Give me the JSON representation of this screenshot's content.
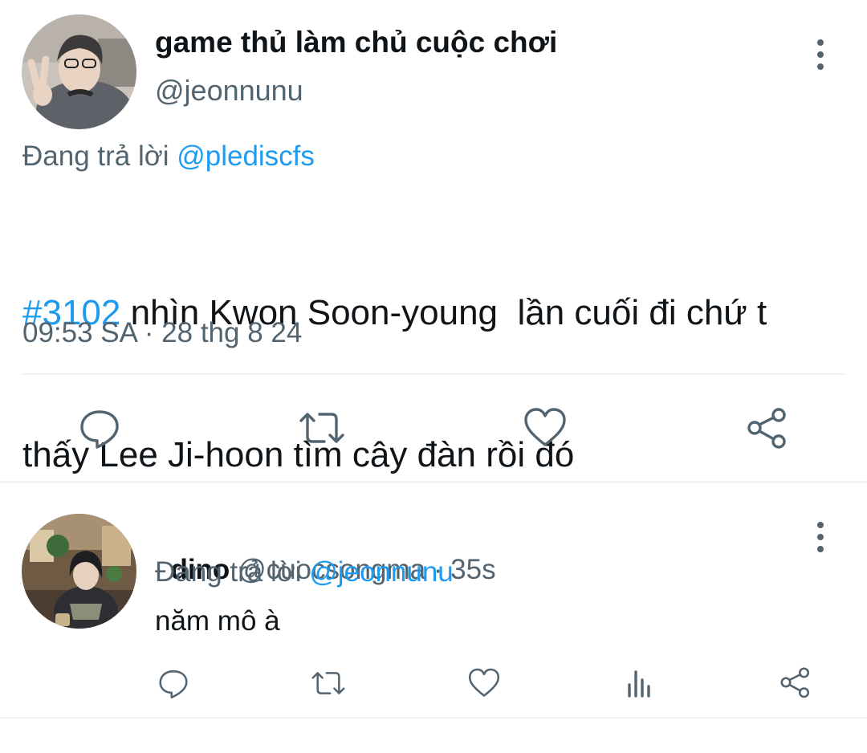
{
  "main_tweet": {
    "display_name": "game thủ làm chủ cuộc chơi",
    "handle": "@jeonnunu",
    "replying_prefix": "Đang trả lời ",
    "replying_to": "@pledisc fs",
    "hashtag": "#3102",
    "text_line1": " nhìn Kwon Soon-young  lần cuối đi chứ t",
    "text_line2": "thấy Lee Ji-hoon tìm cây đàn rồi đó",
    "timestamp": "09:53 SA · 28 thg 8 24"
  },
  "reply": {
    "display_name": "dino",
    "handle": "@cuocsongma",
    "separator": " · ",
    "time": "35s",
    "replying_prefix": "Đang trả lời ",
    "replying_to": "@jeonnunu",
    "text": "năm mô à"
  },
  "colors": {
    "link": "#1d9bf0",
    "muted": "#536471",
    "divider": "#eff3f4"
  },
  "icons": [
    "comment-icon",
    "retweet-icon",
    "like-icon",
    "share-icon",
    "analytics-icon",
    "more-icon"
  ]
}
